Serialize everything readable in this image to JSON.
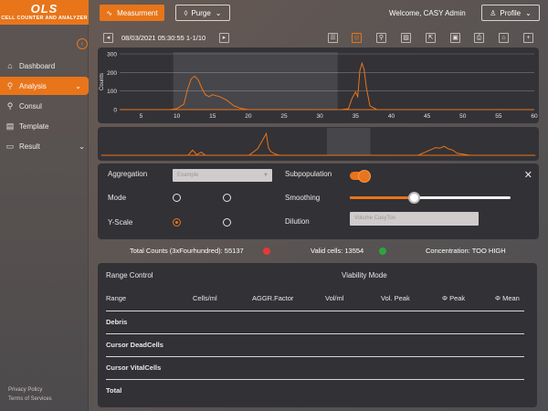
{
  "brand": {
    "logo": "OLS",
    "subtitle": "CELL COUNTER AND ANALYZER"
  },
  "sidebar": {
    "items": [
      {
        "label": "Dashboard",
        "icon": "home-icon"
      },
      {
        "label": "Analysis",
        "icon": "search-icon",
        "active": true
      },
      {
        "label": "Consul",
        "icon": "search-icon"
      },
      {
        "label": "Template",
        "icon": "document-icon"
      },
      {
        "label": "Result",
        "icon": "folder-icon"
      }
    ],
    "footer": {
      "privacy": "Privacy Policy",
      "terms": "Terms of Services"
    }
  },
  "topbar": {
    "measurement_label": "Measurment",
    "purge_label": "Purge",
    "welcome": "Welcome, CASY Admin",
    "profile_label": "Profile"
  },
  "chart_toolbar": {
    "date_text": "08/03/2021  05:30:55  1-1/10"
  },
  "chart_data": [
    {
      "type": "line",
      "ylabel": "Counts",
      "xlim": [
        2,
        60
      ],
      "ylim": [
        0,
        300
      ],
      "x_ticks": [
        5,
        10,
        15,
        20,
        25,
        30,
        35,
        40,
        45,
        50,
        55,
        60
      ],
      "y_ticks": [
        0,
        100,
        200,
        300
      ],
      "grid": true,
      "highlight_range": [
        9.5,
        32.5
      ],
      "color": "#e8751a",
      "x": [
        9.0,
        10.0,
        11.0,
        11.5,
        12.0,
        12.5,
        13.0,
        13.5,
        14.0,
        14.5,
        15.0,
        15.5,
        16.0,
        16.5,
        17.0,
        17.5,
        18.0,
        19.0,
        20.0,
        33.0,
        34.0,
        34.5,
        35.0,
        35.3,
        35.6,
        35.9,
        36.2,
        36.5,
        37.0,
        38.0
      ],
      "y": [
        0,
        5,
        30,
        110,
        165,
        180,
        160,
        115,
        80,
        70,
        80,
        75,
        70,
        60,
        50,
        35,
        20,
        6,
        0,
        0,
        5,
        60,
        95,
        70,
        210,
        250,
        215,
        120,
        20,
        0
      ]
    },
    {
      "type": "line",
      "ylabel": "",
      "xlim": [
        0,
        100
      ],
      "ylim": [
        0,
        100
      ],
      "x_ticks": [],
      "y_ticks": [],
      "grid": false,
      "highlight_range": [
        52,
        62
      ],
      "color": "#e8751a",
      "x": [
        0,
        20,
        21,
        22,
        23,
        24,
        34,
        36,
        37,
        38,
        38.5,
        39,
        40,
        41,
        60,
        65,
        73,
        75,
        76,
        77,
        78,
        79,
        80,
        81,
        82,
        85,
        100
      ],
      "y": [
        0,
        0,
        20,
        2,
        12,
        0,
        0,
        25,
        55,
        85,
        30,
        15,
        5,
        0,
        0,
        0,
        0,
        15,
        22,
        30,
        28,
        35,
        25,
        20,
        8,
        0,
        0
      ]
    }
  ],
  "settings": {
    "aggregation_label": "Aggregation",
    "aggregation_placeholder": "Example",
    "mode_label": "Mode",
    "yscale_label": "Y-Scale",
    "subpopulation_label": "Subpopulation",
    "smoothing_label": "Smoothing",
    "smoothing_value": 0.4,
    "dilution_label": "Dilution",
    "dilution_placeholder": "Volume CasyTon"
  },
  "status": {
    "total_counts": "Total Counts (3xFourhundred): 55137",
    "valid_cells": "Valid cells: 13554",
    "concentration": "Concentration: TOO HIGH",
    "colors": {
      "bad": "#e53935",
      "good": "#2fa43a"
    }
  },
  "results": {
    "range_control": "Range Control",
    "viability_mode": "Viability Mode",
    "headers": [
      "Range",
      "Cells/ml",
      "AGGR.Factor",
      "Vol/ml",
      "Vol. Peak",
      "Φ Peak",
      "Φ Mean"
    ],
    "rows": [
      "Debris",
      "Cursor DeadCells",
      "Cursor VitalCells",
      "Total"
    ]
  },
  "colors": {
    "accent": "#e8751a",
    "panel": "#323136"
  }
}
